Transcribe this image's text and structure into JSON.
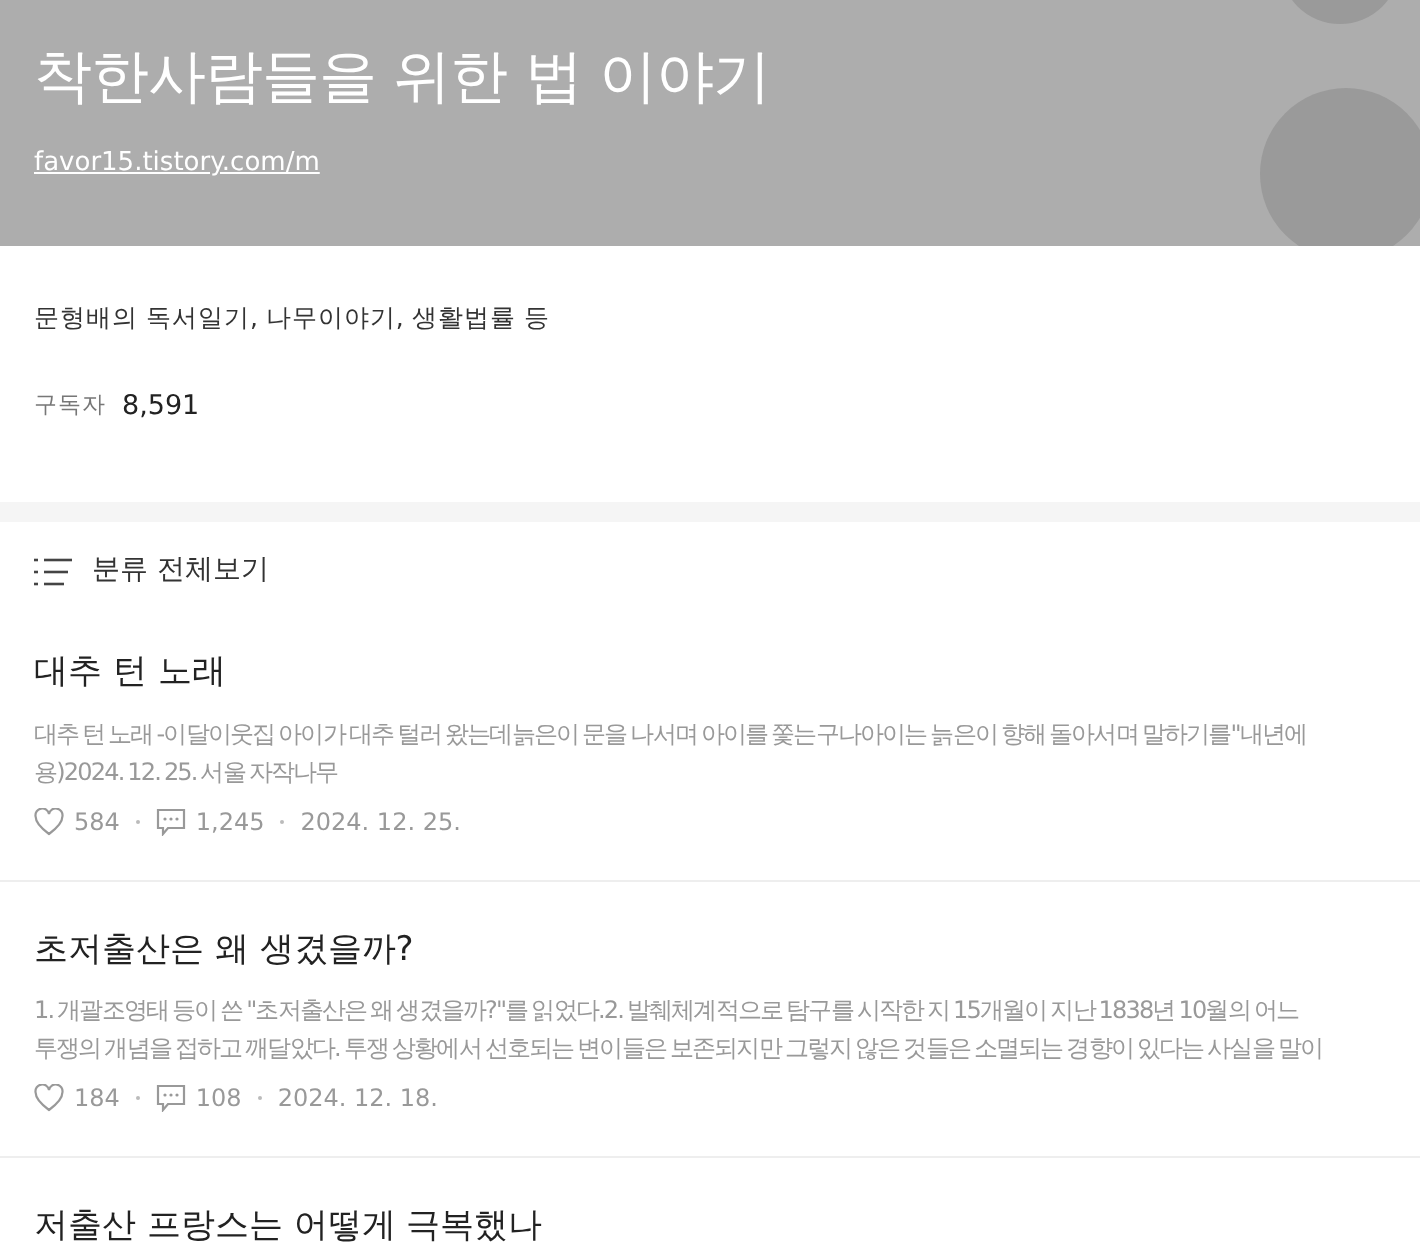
{
  "blog": {
    "title": "착한사람들을 위한 법 이야기",
    "url": "favor15.tistory.com/m"
  },
  "profile": {
    "description": "문형배의 독서일기, 나무이야기, 생활법률 등",
    "subscribers_label": "구독자",
    "subscribers_count": "8,591"
  },
  "category_link": {
    "label": "분류 전체보기"
  },
  "posts": [
    {
      "title": "대추 턴 노래",
      "excerpt_lines": [
        "대추 턴 노래 -이달이웃집 아이가 대추 털러 왔는데늙은이 문을 나서며 아이를 쫓는구나아이는 늙은이 향해 돌아서며 말하기를\"내년에",
        "용)2024. 12. 25. 서울 자작나무"
      ],
      "likes": "584",
      "comments": "1,245",
      "date": "2024. 12. 25."
    },
    {
      "title": "초저출산은 왜 생겼을까?",
      "excerpt_lines": [
        "1. 개괄조영태 등이 쓴 \"초저출산은 왜 생겼을까?\"를 읽었다.2. 발췌체계적으로 탐구를 시작한 지 15개월이 지난 1838년 10월의 어느",
        "투쟁의 개념을 접하고 깨달았다. 투쟁 상황에서 선호되는 변이들은 보존되지만 그렇지 않은 것들은 소멸되는 경향이 있다는 사실을 말이"
      ],
      "likes": "184",
      "comments": "108",
      "date": "2024. 12. 18."
    },
    {
      "title": "저출산 프랑스는 어떻게 극복했나"
    }
  ]
}
